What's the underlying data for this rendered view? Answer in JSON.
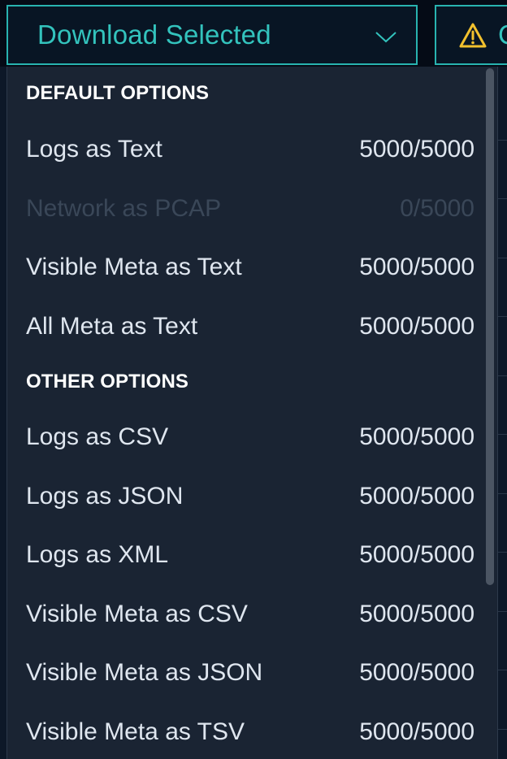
{
  "toolbar": {
    "download_label": "Download Selected",
    "warning_label": "C",
    "icons": [
      "chevron-down-icon",
      "warning-icon"
    ],
    "accent_color": "#33c3bd",
    "warning_color": "#f2c12e"
  },
  "menu": {
    "sections": [
      {
        "title": "DEFAULT OPTIONS",
        "items": [
          {
            "label": "Logs as Text",
            "count": "5000/5000",
            "disabled": false
          },
          {
            "label": "Network as PCAP",
            "count": "0/5000",
            "disabled": true
          },
          {
            "label": "Visible Meta as Text",
            "count": "5000/5000",
            "disabled": false
          },
          {
            "label": "All Meta as Text",
            "count": "5000/5000",
            "disabled": false
          }
        ]
      },
      {
        "title": "OTHER OPTIONS",
        "items": [
          {
            "label": "Logs as CSV",
            "count": "5000/5000",
            "disabled": false
          },
          {
            "label": "Logs as JSON",
            "count": "5000/5000",
            "disabled": false
          },
          {
            "label": "Logs as XML",
            "count": "5000/5000",
            "disabled": false
          },
          {
            "label": "Visible Meta as CSV",
            "count": "5000/5000",
            "disabled": false
          },
          {
            "label": "Visible Meta as JSON",
            "count": "5000/5000",
            "disabled": false
          },
          {
            "label": "Visible Meta as TSV",
            "count": "5000/5000",
            "disabled": false
          }
        ]
      }
    ]
  }
}
